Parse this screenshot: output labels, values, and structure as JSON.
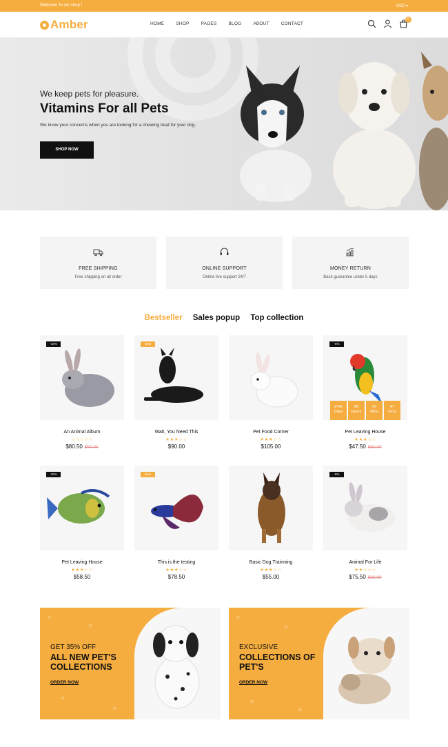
{
  "topbar": {
    "welcome": "Welcome To our shop !",
    "currency": "USD ▾"
  },
  "header": {
    "logo": "Amber",
    "nav": [
      "HOME",
      "SHOP",
      "PAGES",
      "BLOG",
      "ABOUT",
      "CONTACT"
    ],
    "cart_count": "0"
  },
  "hero": {
    "tagline": "We keep pets for pleasure.",
    "headline": "Vitamins For all Pets",
    "description": "We know your concerns when you are looking for a chewing treat for your dog.",
    "button": "SHOP NOW"
  },
  "services": [
    {
      "title": "FREE SHIPPING",
      "subtitle": "Free shipping on all order",
      "icon": "truck-icon"
    },
    {
      "title": "ONLINE SUPPORT",
      "subtitle": "Online live support 24/7",
      "icon": "headset-icon"
    },
    {
      "title": "MONEY RETURN",
      "subtitle": "Back guarantee under 5 days",
      "icon": "chart-icon"
    }
  ],
  "tabs": [
    "Bestseller",
    "Sales popup",
    "Top collection"
  ],
  "products": [
    {
      "name": "An Animal Album",
      "price": "$80.50",
      "old_price": "$90.00",
      "badge": "-10%",
      "stars": "☆☆☆☆☆"
    },
    {
      "name": "Wait, You Need This",
      "price": "$90.00",
      "old_price": "",
      "badge": "New",
      "stars": "★★★☆☆"
    },
    {
      "name": "Pet Food Corner",
      "price": "$105.00",
      "old_price": "",
      "badge": "",
      "stars": "★★★☆☆"
    },
    {
      "name": "Pet Leaving House",
      "price": "$47.50",
      "old_price": "$50.00",
      "badge": "-5%",
      "stars": "★★★☆☆"
    },
    {
      "name": "Pet Leaving House",
      "price": "$58.50",
      "old_price": "",
      "badge": "-10%",
      "stars": "★★★☆☆"
    },
    {
      "name": "This is the testing",
      "price": "$78.50",
      "old_price": "",
      "badge": "New",
      "stars": "★★★☆☆"
    },
    {
      "name": "Basic Dog Trainning",
      "price": "$55.00",
      "old_price": "",
      "badge": "",
      "stars": "★★★☆☆"
    },
    {
      "name": "Animal For Life",
      "price": "$75.50",
      "old_price": "$80.00",
      "badge": "-5%",
      "stars": "★★☆☆☆"
    }
  ],
  "countdown": [
    {
      "value": "2742",
      "unit": "Days"
    },
    {
      "value": "08",
      "unit": "Hours"
    },
    {
      "value": "43",
      "unit": "Mins"
    },
    {
      "value": "47",
      "unit": "Secs"
    }
  ],
  "banners": [
    {
      "line1": "GET 35% OFF",
      "line2": "ALL NEW PET'S COLLECTIONS",
      "link": "ORDER NOW"
    },
    {
      "line1": "EXCLUSIVE",
      "line2": "COLLECTIONS OF PET'S",
      "link": "ORDER NOW"
    }
  ],
  "colors": {
    "accent": "#f6ad3f",
    "dark": "#111111",
    "card_bg": "#f6f6f6"
  }
}
